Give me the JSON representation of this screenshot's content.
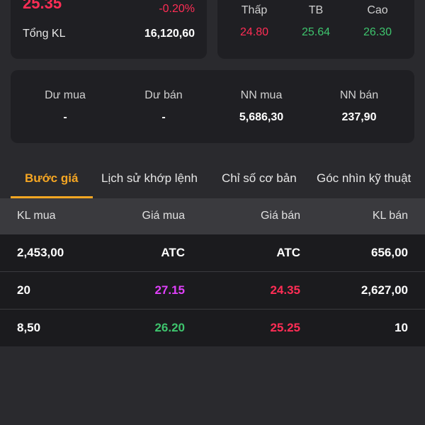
{
  "price_card": {
    "price": "25.35",
    "change_pct": "-0.20%",
    "volume_label": "Tổng KL",
    "volume_value": "16,120,60"
  },
  "range_card": {
    "low": {
      "label": "Thấp",
      "value": "24.80"
    },
    "avg": {
      "label": "TB",
      "value": "25.64"
    },
    "high": {
      "label": "Cao",
      "value": "26.30"
    }
  },
  "market_card": {
    "items": [
      {
        "label": "Dư mua",
        "value": "-"
      },
      {
        "label": "Dư bán",
        "value": "-"
      },
      {
        "label": "NN mua",
        "value": "5,686,30"
      },
      {
        "label": "NN bán",
        "value": "237,90"
      }
    ]
  },
  "tabs": [
    {
      "label": "Bước giá",
      "active": true
    },
    {
      "label": "Lịch sử khớp lệnh",
      "active": false
    },
    {
      "label": "Chỉ số cơ bản",
      "active": false
    },
    {
      "label": "Góc nhìn kỹ thuật",
      "active": false
    }
  ],
  "order_book": {
    "headers": [
      "KL mua",
      "Giá mua",
      "Giá bán",
      "KL bán"
    ],
    "rows": [
      {
        "bid_vol": "2,453,00",
        "bid_price": "ATC",
        "ask_price": "ATC",
        "ask_vol": "656,00"
      },
      {
        "bid_vol": "20",
        "bid_price": "27.15",
        "ask_price": "24.35",
        "ask_vol": "2,627,00"
      },
      {
        "bid_vol": "8,50",
        "bid_price": "26.20",
        "ask_price": "25.25",
        "ask_vol": "10"
      }
    ]
  },
  "colors": {
    "red": "#ff2d55",
    "green": "#3ec46d",
    "magenta": "#e040fb",
    "white": "#ffffff",
    "accent": "#f5a623"
  }
}
